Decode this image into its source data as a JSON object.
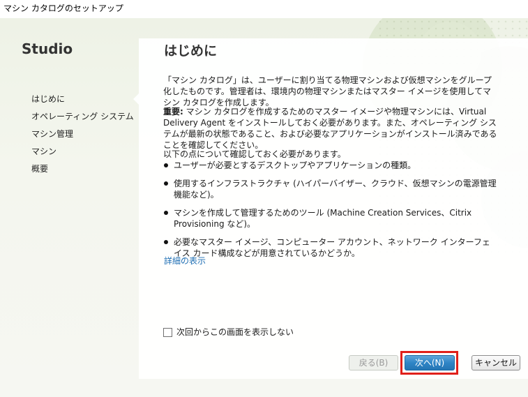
{
  "window": {
    "title": "マシン カタログのセットアップ"
  },
  "sidebar": {
    "title": "Studio",
    "steps": [
      {
        "label": "はじめに"
      },
      {
        "label": "オペレーティング システム"
      },
      {
        "label": "マシン管理"
      },
      {
        "label": "マシン"
      },
      {
        "label": "概要"
      }
    ],
    "current_step": "はじめに"
  },
  "main": {
    "heading": "はじめに",
    "intro": "「マシン カタログ」は、ユーザーに割り当てる物理マシンおよび仮想マシンをグループ化したものです。管理者は、環境内の物理マシンまたはマスター イメージを使用してマシン カタログを作成します。",
    "important_label": "重要:",
    "important_text": " マシン カタログを作成するためのマスター イメージや物理マシンには、Virtual Delivery Agent をインストールしておく必要があります。また、オペレーティング システムが最新の状態であること、および必要なアプリケーションがインストール済みであることを確認してください。",
    "checklist_intro": "以下の点について確認しておく必要があります。",
    "checklist": [
      "ユーザーが必要とするデスクトップやアプリケーションの種類。",
      "使用するインフラストラクチャ (ハイパーバイザー、クラウド、仮想マシンの電源管理機能など)。",
      "マシンを作成して管理するためのツール (Machine Creation Services、Citrix Provisioning など)。",
      "必要なマスター イメージ、コンピューター アカウント、ネットワーク インターフェイス カード構成などが用意されているかどうか。"
    ],
    "more_link": "詳細の表示",
    "dont_show_label": "次回からこの画面を表示しない",
    "dont_show_checked": false
  },
  "buttons": {
    "back": "戻る(B)",
    "next": "次へ(N)",
    "cancel": "キャンセル"
  },
  "colors": {
    "accent": "#2f85c6",
    "highlight_frame": "#e0201a",
    "link": "#1f6fb4"
  }
}
